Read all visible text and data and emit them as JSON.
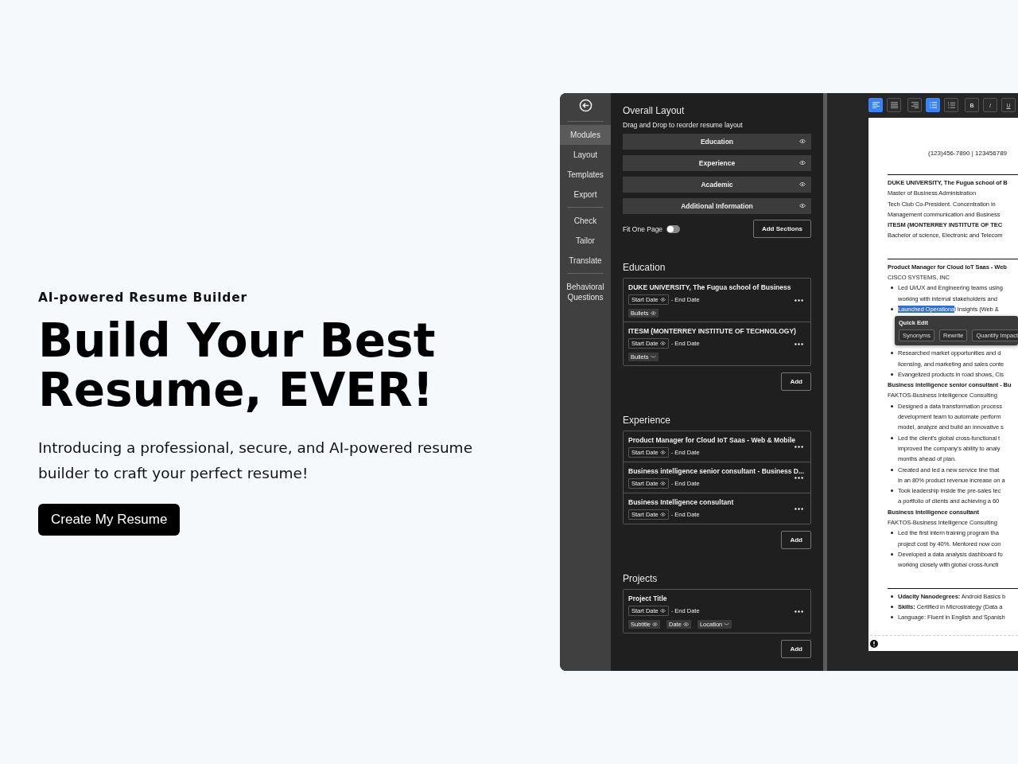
{
  "hero": {
    "eyebrow": "AI-powered Resume Builder",
    "headline": "Build Your Best Resume, EVER!",
    "subtitle": "Introducing a professional, secure, and AI-powered resume builder to craft your perfect resume!",
    "cta": "Create My Resume"
  },
  "app": {
    "sidebar": {
      "groups": [
        [
          {
            "label": "Modules",
            "selected": true
          },
          {
            "label": "Layout",
            "selected": false
          },
          {
            "label": "Templates",
            "selected": false
          },
          {
            "label": "Export",
            "selected": false
          }
        ],
        [
          {
            "label": "Check",
            "selected": false
          },
          {
            "label": "Tailor",
            "selected": false
          },
          {
            "label": "Translate",
            "selected": false
          }
        ],
        [
          {
            "label": "Behavioral Questions",
            "selected": false
          }
        ]
      ]
    },
    "overall_layout": {
      "title": "Overall Layout",
      "hint": "Drag and Drop to reorder resume layout",
      "sections": [
        {
          "label": "Education",
          "visible": true
        },
        {
          "label": "Experience",
          "visible": true
        },
        {
          "label": "Academic",
          "visible": true
        },
        {
          "label": "Additional Information",
          "visible": true
        }
      ],
      "fit_one_page": {
        "label": "Fit One Page",
        "on": false
      },
      "add_sections": "Add Sections"
    },
    "modules": [
      {
        "title": "Education",
        "add": "Add",
        "entries": [
          {
            "title": "DUKE UNIVERSITY, The Fugua school of Business",
            "start": {
              "label": "Start Date",
              "visible": true
            },
            "end": "- End Date",
            "chips": [
              {
                "label": "Bullets",
                "visible": true
              }
            ]
          },
          {
            "title": "ITESM (MONTERREY INSTITUTE OF TECHNOLOGY)",
            "start": {
              "label": "Start Date",
              "visible": true
            },
            "end": "- End Date",
            "chips": [
              {
                "label": "Bullets",
                "visible": false
              }
            ]
          }
        ]
      },
      {
        "title": "Experience",
        "add": "Add",
        "entries": [
          {
            "title": "Product Manager for Cloud IoT Saas - Web & Mobile",
            "start": {
              "label": "Start Date",
              "visible": true
            },
            "end": "- End Date"
          },
          {
            "title": "Business intelligence senior consultant - Business D...",
            "start": {
              "label": "Start Date",
              "visible": true
            },
            "end": "- End Date"
          },
          {
            "title": "Business Intelligence consultant",
            "start": {
              "label": "Start Date",
              "visible": true
            },
            "end": "- End Date"
          }
        ]
      },
      {
        "title": "Projects",
        "add": "Add",
        "entries": [
          {
            "title": "Project Title",
            "start": {
              "label": "Start Date",
              "visible": true
            },
            "end": "- End Date",
            "chips": [
              {
                "label": "Subtitle",
                "visible": true
              },
              {
                "label": "Date",
                "visible": true
              },
              {
                "label": "Location",
                "visible": false
              }
            ]
          }
        ]
      }
    ],
    "toolbar": [
      [
        {
          "kind": "align-left",
          "selected": true
        },
        {
          "kind": "justify",
          "selected": false
        }
      ],
      [
        {
          "kind": "align-right",
          "selected": false
        },
        {
          "kind": "bullet-list",
          "selected": true
        },
        {
          "kind": "numbered-list",
          "selected": false
        }
      ],
      [
        {
          "kind": "bold",
          "label": "B",
          "selected": false
        },
        {
          "kind": "italic",
          "label": "I",
          "selected": false
        },
        {
          "kind": "underline",
          "label": "U",
          "selected": false
        }
      ]
    ],
    "resume": {
      "contact": "(123)456-7890 | 123456789",
      "sections": [
        [
          {
            "kind": "title",
            "text": "DUKE UNIVERSITY, The Fugua school of B"
          },
          {
            "kind": "line",
            "text": "Master of Business Administration"
          },
          {
            "kind": "line",
            "text": "Tech Club Co-President. Concentration in"
          },
          {
            "kind": "line",
            "text": "Management communication and Business"
          },
          {
            "kind": "title",
            "text": "ITESM (MONTERREY INSTITUTE OF TEC"
          },
          {
            "kind": "line",
            "text": "Bachelor of science, Electronic and Telecom"
          }
        ],
        [
          {
            "kind": "title",
            "text": "Product Manager for Cloud IoT Saas - Web"
          },
          {
            "kind": "line",
            "text": "CISCO SYSTEMS, INC"
          },
          {
            "kind": "bullet",
            "lines": [
              "Led UI/UX and Engineering teams using",
              "working with internal stakeholders and"
            ]
          },
          {
            "kind": "bullet",
            "highlight": "Launched Operationa",
            "lines": [
              "l Insights (Web &"
            ]
          },
          {
            "kind": "popup",
            "title": "Quick Edit",
            "actions": [
              "Synonyms",
              "Rewrite",
              "Quantify Impact"
            ]
          },
          {
            "kind": "bullet",
            "lines": [
              "Researched market opportunities and d",
              "licensing, and marketing and sales conte"
            ]
          },
          {
            "kind": "bullet",
            "lines": [
              "Evangelized products in road shows, Cis"
            ]
          },
          {
            "kind": "title",
            "text": "Business intelligence senior consultant - Bu"
          },
          {
            "kind": "line",
            "text": "FAKTOS-Business Intelligence Consulting"
          },
          {
            "kind": "bullet",
            "lines": [
              "Designed a data transformation process",
              "development team to automate perform",
              "model, analyze and build an innovative s"
            ]
          },
          {
            "kind": "bullet",
            "lines": [
              "Led the client's global cross-functional t",
              "improved the company's ability to analy",
              "months ahead of plan."
            ]
          },
          {
            "kind": "bullet",
            "lines": [
              "Created and led a new service line that",
              "in an 80% product revenue increase on a"
            ]
          },
          {
            "kind": "bullet",
            "lines": [
              "Took leadership inside the pre-sales tec",
              "a portfolio of clients and achieving a 60"
            ]
          },
          {
            "kind": "title",
            "text": "Business Intelligence consultant"
          },
          {
            "kind": "line",
            "text": "FAKTOS-Business Intelligence Consulting"
          },
          {
            "kind": "bullet",
            "lines": [
              "Led the first intern training program tha",
              "project cost by 40%. Mentored now con"
            ]
          },
          {
            "kind": "bullet",
            "lines": [
              "Developed a data analysis dashboard fo",
              "working closely with global cross-functi"
            ]
          }
        ],
        [
          {
            "kind": "bullet",
            "lines": [
              "**Udacity Nanodegrees:** Android Basics b"
            ]
          },
          {
            "kind": "bullet",
            "lines": [
              "**Skills:** Certified in Microstrategy (Data a"
            ]
          },
          {
            "kind": "bullet",
            "lines": [
              "Language: Fluent in English and Spanish"
            ]
          }
        ]
      ]
    }
  }
}
